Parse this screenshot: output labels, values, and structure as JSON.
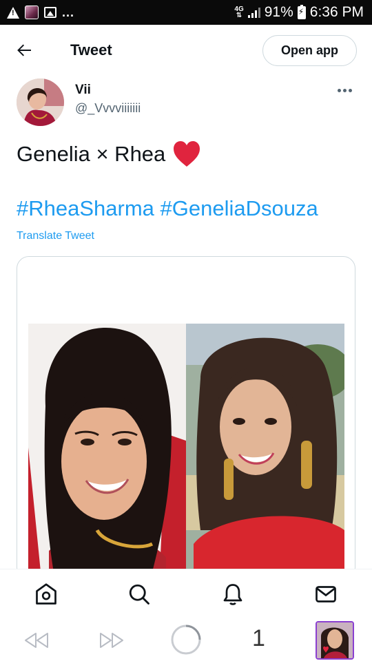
{
  "status_bar": {
    "dots": "...",
    "network": "4G",
    "battery": "91%",
    "time": "6:36 PM"
  },
  "header": {
    "title": "Tweet",
    "open_app_label": "Open app"
  },
  "author": {
    "name": "Vii",
    "handle": "@_Vvvviiiiiii"
  },
  "tweet": {
    "text": "Genelia × Rhea",
    "hashtags": [
      "#RheaSharma",
      "#GeneliaDsouza"
    ],
    "translate_label": "Translate Tweet"
  },
  "tabs": [
    "home-icon",
    "search-icon",
    "notifications-icon",
    "messages-icon"
  ],
  "browser": {
    "tab_count": "1"
  },
  "colors": {
    "accent": "#1d9bf0",
    "text": "#0f1419",
    "secondary_text": "#536471",
    "heart": "#e0243e",
    "tab_border": "#8a3fd1"
  }
}
